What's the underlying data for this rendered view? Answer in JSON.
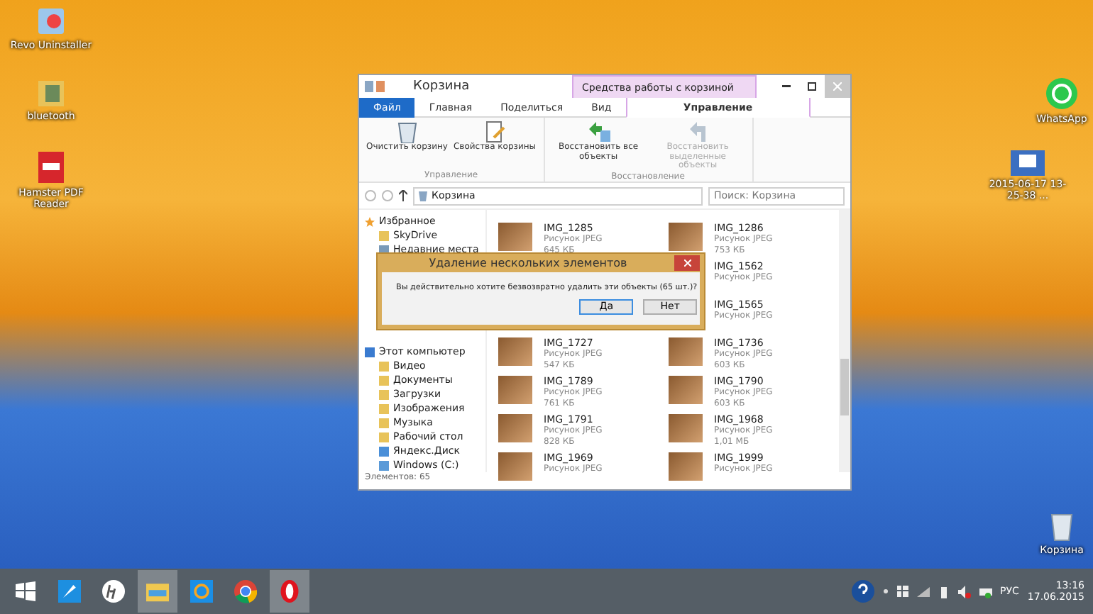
{
  "desktop_icons_left": [
    {
      "label": "Revo Uninstaller",
      "kind": "revo"
    },
    {
      "label": "bluetooth",
      "kind": "folder"
    },
    {
      "label": "Hamster PDF Reader",
      "kind": "pdf"
    }
  ],
  "desktop_icons_right": [
    {
      "label": "WhatsApp",
      "kind": "whatsapp"
    },
    {
      "label": "2015-06-17 13-25-38 ...",
      "kind": "screenshot"
    },
    {
      "label": "Корзина",
      "kind": "trash"
    }
  ],
  "window": {
    "title": "Корзина",
    "context_header": "Средства работы с корзиной",
    "tabs": [
      {
        "label": "Файл",
        "kind": "file",
        "selected": false
      },
      {
        "label": "Главная",
        "kind": "tab",
        "selected": false
      },
      {
        "label": "Поделиться",
        "kind": "tab",
        "selected": false
      },
      {
        "label": "Вид",
        "kind": "tab",
        "selected": false
      },
      {
        "label": "Управление",
        "kind": "context",
        "selected": true
      }
    ],
    "ribbon_groups": [
      {
        "label": "Управление",
        "buttons": [
          {
            "label": "Очистить корзину",
            "kind": "bin",
            "disabled": false
          },
          {
            "label": "Свойства корзины",
            "kind": "props",
            "disabled": false
          }
        ]
      },
      {
        "label": "Восстановление",
        "buttons": [
          {
            "label": "Восстановить все объекты",
            "kind": "restore_all",
            "disabled": false
          },
          {
            "label": "Восстановить выделенные объекты",
            "kind": "restore_sel",
            "disabled": true
          }
        ]
      }
    ],
    "address": "Корзина",
    "search": {
      "placeholder": "Поиск: Корзина"
    },
    "nav": [
      {
        "label": "Избранное",
        "kind": "star",
        "children": [
          {
            "label": "SkyDrive",
            "kind": "folder"
          },
          {
            "label": "Недавние места",
            "kind": "recent"
          }
        ]
      },
      {
        "label": "Этот компьютер",
        "kind": "pc",
        "children": [
          {
            "label": "Видео",
            "kind": "folder"
          },
          {
            "label": "Документы",
            "kind": "folder"
          },
          {
            "label": "Загрузки",
            "kind": "folder"
          },
          {
            "label": "Изображения",
            "kind": "folder"
          },
          {
            "label": "Музыка",
            "kind": "folder"
          },
          {
            "label": "Рабочий стол",
            "kind": "folder"
          },
          {
            "label": "Яндекс.Диск",
            "kind": "cloud"
          },
          {
            "label": "Windows (C:)",
            "kind": "drive"
          }
        ]
      }
    ],
    "file_rows": [
      {
        "left": {
          "name": "IMG_1285",
          "type": "Рисунок JPEG",
          "size": "645 КБ"
        },
        "right": {
          "name": "IMG_1286",
          "type": "Рисунок JPEG",
          "size": "753 КБ"
        }
      },
      {
        "right": {
          "name": "IMG_1562",
          "type": "Рисунок JPEG"
        }
      },
      {
        "right": {
          "name": "IMG_1565",
          "type": "Рисунок JPEG"
        }
      },
      {
        "left": {
          "name": "IMG_1727",
          "type": "Рисунок JPEG",
          "size": "547 КБ"
        },
        "right": {
          "name": "IMG_1736",
          "type": "Рисунок JPEG",
          "size": "603 КБ"
        }
      },
      {
        "left": {
          "name": "IMG_1789",
          "type": "Рисунок JPEG",
          "size": "761 КБ"
        },
        "right": {
          "name": "IMG_1790",
          "type": "Рисунок JPEG",
          "size": "603 КБ"
        }
      },
      {
        "left": {
          "name": "IMG_1791",
          "type": "Рисунок JPEG",
          "size": "828 КБ"
        },
        "right": {
          "name": "IMG_1968",
          "type": "Рисунок JPEG",
          "size": "1,01 МБ"
        }
      },
      {
        "left": {
          "name": "IMG_1969",
          "type": "Рисунок JPEG"
        },
        "right": {
          "name": "IMG_1999",
          "type": "Рисунок JPEG"
        }
      }
    ],
    "status": "Элементов: 65"
  },
  "dialog": {
    "title": "Удаление нескольких элементов",
    "message": "Вы действительно хотите безвозвратно удалить эти объекты (65 шт.)?",
    "buttons": [
      {
        "label": "Да",
        "selected": true
      },
      {
        "label": "Нет",
        "selected": false
      }
    ]
  },
  "taskbar": {
    "apps": [
      {
        "kind": "rocket",
        "active": false
      },
      {
        "kind": "hp",
        "active": false
      },
      {
        "kind": "explorer",
        "active": true
      },
      {
        "kind": "mail",
        "active": false
      },
      {
        "kind": "chrome",
        "active": false
      },
      {
        "kind": "opera",
        "active": true
      }
    ],
    "language": "РУС",
    "time": "13:16",
    "date": "17.06.2015"
  }
}
